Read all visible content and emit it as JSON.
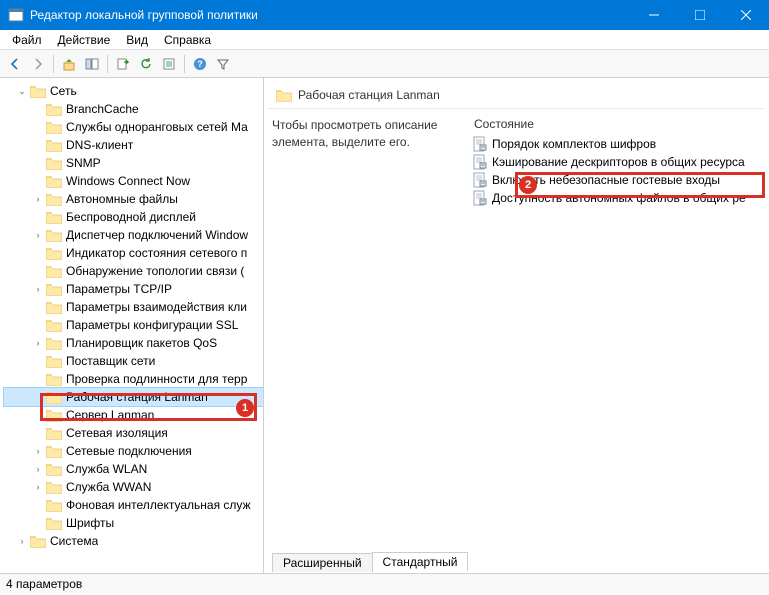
{
  "window": {
    "title": "Редактор локальной групповой политики"
  },
  "menu": {
    "file": "Файл",
    "action": "Действие",
    "view": "Вид",
    "help": "Справка"
  },
  "tree": {
    "root": "Сеть",
    "items": [
      "BranchCache",
      "Службы одноранговых сетей Ма",
      "DNS-клиент",
      "SNMP",
      "Windows Connect Now",
      "Автономные файлы",
      "Беспроводной дисплей",
      "Диспетчер подключений Window",
      "Индикатор состояния сетевого п",
      "Обнаружение топологии связи (",
      "Параметры TCP/IP",
      "Параметры взаимодействия кли",
      "Параметры конфигурации SSL",
      "Планировщик пакетов QoS",
      "Поставщик сети",
      "Проверка подлинности для терр",
      "Рабочая станция Lanman",
      "Сервер Lanman",
      "Сетевая изоляция",
      "Сетевые подключения",
      "Служба WLAN",
      "Служба WWAN",
      "Фоновая интеллектуальная служ",
      "Шрифты"
    ],
    "after": "Система"
  },
  "detail": {
    "heading": "Рабочая станция Lanman",
    "hint": "Чтобы просмотреть описание элемента, выделите его.",
    "column": "Состояние",
    "settings": [
      "Порядок комплектов шифров",
      "Кэширование дескрипторов в общих ресурса",
      "Включить небезопасные гостевые входы",
      "Доступность автономных файлов в общих ре"
    ],
    "tabs": {
      "extended": "Расширенный",
      "standard": "Стандартный"
    }
  },
  "status": {
    "text": "4 параметров"
  },
  "badges": {
    "one": "1",
    "two": "2"
  }
}
